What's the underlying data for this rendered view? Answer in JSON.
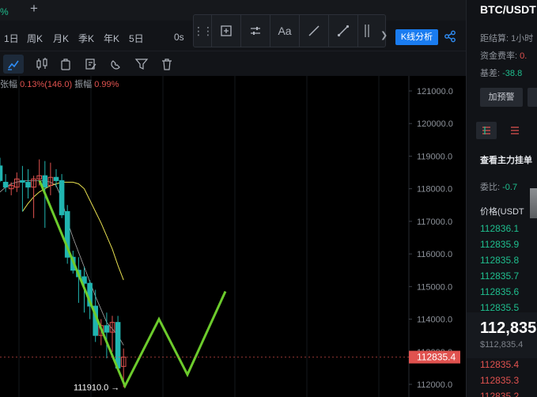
{
  "tabbar": {
    "fragment": "%",
    "new_tab": "+"
  },
  "periods": [
    {
      "label": "1日"
    },
    {
      "label": "周K"
    },
    {
      "label": "月K"
    },
    {
      "label": "季K"
    },
    {
      "label": "年K"
    },
    {
      "label": "5日"
    },
    {
      "label": "0s"
    }
  ],
  "draw_toolbar": {
    "text_tool": "Aa"
  },
  "analysis_button": "K线分析",
  "stats": {
    "change_label": "张幅",
    "change_value": "0.13%(146.0)",
    "amplitude_label": "振幅",
    "amplitude_value": "0.99%"
  },
  "chart_data": {
    "type": "candlestick",
    "y_ticks": [
      "121000.0",
      "120000.0",
      "119000.0",
      "118000.0",
      "117000.0",
      "116000.0",
      "115000.0",
      "114000.0",
      "113000.0",
      "112000.0"
    ],
    "last_price_tag": "112835.4",
    "low_marker": "111910.0 →",
    "up_color": "#e0524f",
    "down_color": "#21b5b0",
    "ma_fast_color": "#f0f0f0",
    "ma_slow_color": "#e8e050",
    "drawing_color": "#6ccb2c",
    "candles": [
      {
        "o": 118700,
        "h": 118950,
        "l": 118200,
        "c": 118250
      },
      {
        "o": 118200,
        "h": 118450,
        "l": 117900,
        "c": 118050
      },
      {
        "o": 118000,
        "h": 118200,
        "l": 117800,
        "c": 118100
      },
      {
        "o": 118050,
        "h": 118500,
        "l": 117900,
        "c": 118300
      },
      {
        "o": 118250,
        "h": 118700,
        "l": 117300,
        "c": 118200
      },
      {
        "o": 118200,
        "h": 118600,
        "l": 117700,
        "c": 118050
      },
      {
        "o": 118050,
        "h": 118400,
        "l": 117100,
        "c": 118300
      },
      {
        "o": 118300,
        "h": 118900,
        "l": 118100,
        "c": 118400
      },
      {
        "o": 118400,
        "h": 118850,
        "l": 116800,
        "c": 118050
      },
      {
        "o": 118100,
        "h": 118800,
        "l": 117800,
        "c": 118350
      },
      {
        "o": 118350,
        "h": 118600,
        "l": 118050,
        "c": 118250
      },
      {
        "o": 118250,
        "h": 118450,
        "l": 117100,
        "c": 117200
      },
      {
        "o": 117300,
        "h": 117500,
        "l": 115700,
        "c": 115900
      },
      {
        "o": 115900,
        "h": 116100,
        "l": 115400,
        "c": 115500
      },
      {
        "o": 115500,
        "h": 115900,
        "l": 114500,
        "c": 115300
      },
      {
        "o": 115300,
        "h": 115600,
        "l": 114200,
        "c": 115100
      },
      {
        "o": 115100,
        "h": 115200,
        "l": 114000,
        "c": 114400
      },
      {
        "o": 114400,
        "h": 114900,
        "l": 113300,
        "c": 113500
      },
      {
        "o": 113500,
        "h": 114000,
        "l": 113200,
        "c": 113800
      },
      {
        "o": 113800,
        "h": 114200,
        "l": 112800,
        "c": 113600
      },
      {
        "o": 113600,
        "h": 114100,
        "l": 113000,
        "c": 113900
      },
      {
        "o": 113900,
        "h": 114100,
        "l": 112400,
        "c": 112500
      },
      {
        "o": 112550,
        "h": 113100,
        "l": 111910,
        "c": 112835
      }
    ],
    "ma_fast": [
      117900,
      118050,
      118150,
      118200,
      118250,
      118250,
      118250,
      118250,
      118250,
      118200,
      118100,
      117700,
      117000,
      116500,
      116050,
      115600,
      115150,
      114700,
      114300,
      113900,
      113700,
      113500,
      113200
    ],
    "ma_slow": [
      117300,
      117550,
      117750,
      117900,
      118000,
      118100,
      118150,
      118200,
      118200,
      118200,
      118150,
      118000,
      117650,
      117300,
      116950,
      116550,
      116150,
      115650,
      115200
    ],
    "drawing_polyline": [
      [
        118250,
        0
      ],
      [
        111950,
        0
      ],
      [
        114000,
        0
      ],
      [
        112300,
        0
      ],
      [
        114850,
        0
      ]
    ]
  },
  "right_panel": {
    "symbol": "BTC/USDT",
    "settle_label": "距结算:",
    "settle_value": "1小时",
    "funding_label": "资金费率:",
    "funding_value": "0.",
    "basis_label": "基差:",
    "basis_value": "-38.8",
    "alert_button": "加预警",
    "main_force": "查看主力挂单",
    "ratio_label": "委比:",
    "ratio_value": "-0.7",
    "price_header": "价格(USDT",
    "asks": [
      "112836.1",
      "112835.9",
      "112835.8",
      "112835.7",
      "112835.6",
      "112835.5"
    ],
    "last_price": "112,835",
    "usd_price": "$112,835.4",
    "bids": [
      "112835.4",
      "112835.3",
      "112835.2"
    ]
  }
}
